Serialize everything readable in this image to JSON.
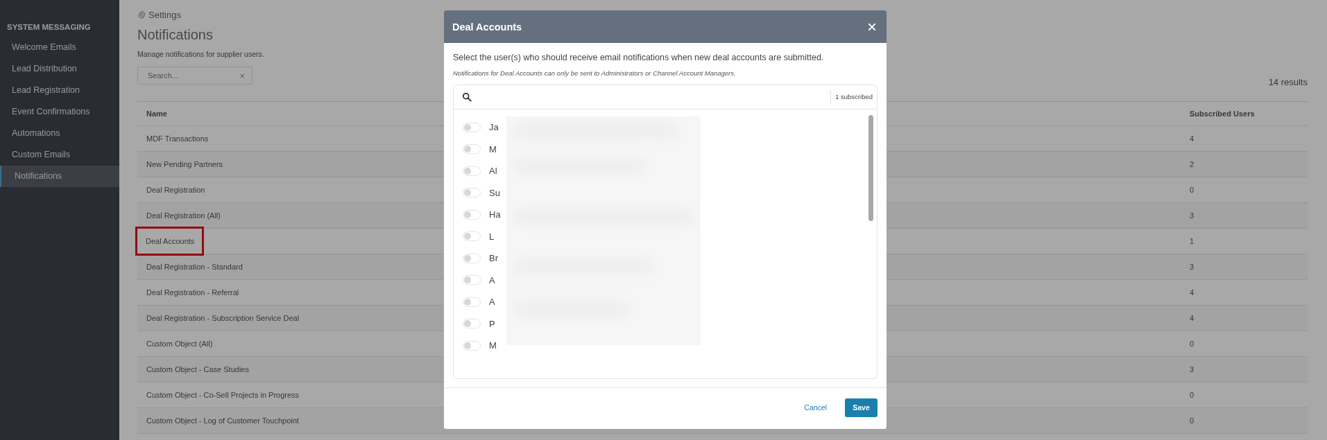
{
  "sidebar": {
    "heading": "SYSTEM MESSAGING",
    "items": [
      {
        "label": "Welcome Emails",
        "selected": false
      },
      {
        "label": "Lead Distribution",
        "selected": false
      },
      {
        "label": "Lead Registration",
        "selected": false
      },
      {
        "label": "Event Confirmations",
        "selected": false
      },
      {
        "label": "Automations",
        "selected": false
      },
      {
        "label": "Custom Emails",
        "selected": false
      },
      {
        "label": "Notifications",
        "selected": true
      }
    ]
  },
  "breadcrumb": "Settings",
  "title": "Notifications",
  "subtitle": "Manage notifications for supplier users.",
  "search": {
    "placeholder": "Search...",
    "clear": "×"
  },
  "results": "14 results",
  "table": {
    "columns": [
      "Name",
      "Subscribed Users"
    ],
    "rows": [
      {
        "name": "MDF Transactions",
        "subscribed": "4",
        "highlighted": false
      },
      {
        "name": "New Pending Partners",
        "subscribed": "2",
        "highlighted": false
      },
      {
        "name": "Deal Registration",
        "subscribed": "0",
        "highlighted": false
      },
      {
        "name": "Deal Registration (All)",
        "subscribed": "3",
        "highlighted": false
      },
      {
        "name": "Deal Accounts",
        "subscribed": "1",
        "highlighted": true
      },
      {
        "name": "Deal Registration - Standard",
        "subscribed": "3",
        "highlighted": false
      },
      {
        "name": "Deal Registration - Referral",
        "subscribed": "4",
        "highlighted": false
      },
      {
        "name": "Deal Registration - Subscription Service Deal",
        "subscribed": "4",
        "highlighted": false
      },
      {
        "name": "Custom Object (All)",
        "subscribed": "0",
        "highlighted": false
      },
      {
        "name": "Custom Object - Case Studies",
        "subscribed": "3",
        "highlighted": false
      },
      {
        "name": "Custom Object - Co-Sell Projects in Progress",
        "subscribed": "0",
        "highlighted": false
      },
      {
        "name": "Custom Object - Log of Customer Touchpoint",
        "subscribed": "0",
        "highlighted": false
      }
    ]
  },
  "modal": {
    "title": "Deal Accounts",
    "close": "×",
    "description": "Select the user(s) who should receive email notifications when new deal accounts are submitted.",
    "note": "Notifications for Deal Accounts can only be sent to Administrators or Channel Account Managers.",
    "subscribed_count": "1 subscribed",
    "users": [
      {
        "name": "Ja",
        "on": false
      },
      {
        "name": "M",
        "on": false
      },
      {
        "name": "Al",
        "on": false
      },
      {
        "name": "Su",
        "on": false
      },
      {
        "name": "Ha",
        "on": false
      },
      {
        "name": "L",
        "on": false
      },
      {
        "name": "Br",
        "on": false
      },
      {
        "name": "A",
        "on": false
      },
      {
        "name": "A",
        "on": false
      },
      {
        "name": "P",
        "on": false
      },
      {
        "name": "M",
        "on": false
      }
    ],
    "buttons": {
      "cancel": "Cancel",
      "save": "Save"
    }
  }
}
